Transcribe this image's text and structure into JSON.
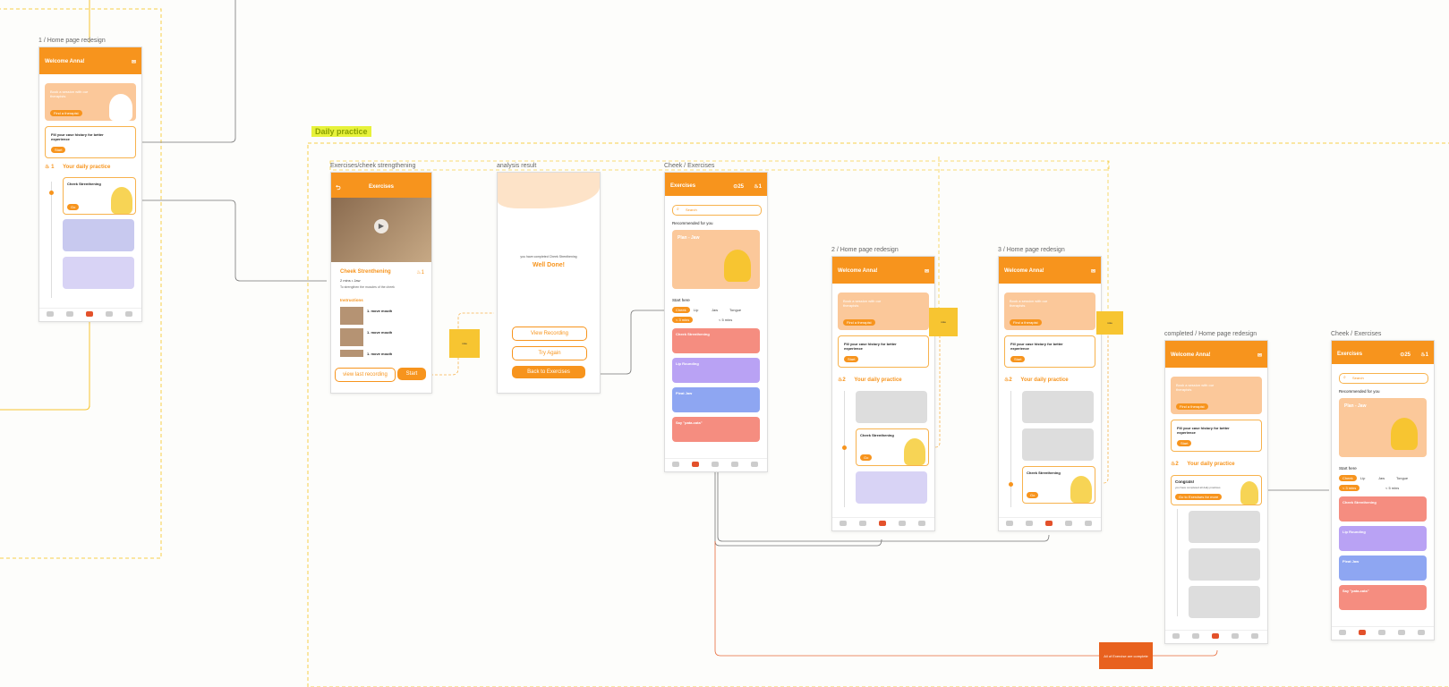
{
  "section_title": "Daily practice",
  "frames": {
    "home1": "1 / Home page redesign",
    "exercise": "Exercises/cheek strengthening",
    "analysis": "analysis result",
    "cheek": "Cheek / Exercises",
    "home2": "2 / Home page redesign",
    "home3": "3 / Home page redesign",
    "completed": "completed / Home page redesign",
    "cheek2": "Cheek / Exercises"
  },
  "home": {
    "welcome": "Welcome Anna!",
    "book_text": "Book a session with our therapists",
    "find_btn": "Find a therapist",
    "fill_text": "Fill your case history for better experience",
    "start_btn": "Start",
    "streak": "1",
    "streak2": "2",
    "daily": "Your daily practice",
    "cheek_title": "Cheek Strenthening",
    "go_btn": "Go"
  },
  "exercise": {
    "header": "Exercises",
    "title": "Cheek Strenthening",
    "meta": "2 mins • Jaw",
    "desc": "To strengthen the muscles of the cheek",
    "instructions": "Instructions",
    "step": "1. move mouth",
    "view_last": "view last recording",
    "start": "Start"
  },
  "analysis": {
    "completed": "you have completed Cheek Strenthening",
    "well_done": "Well Done!",
    "view_recording": "View Recording",
    "try_again": "Try Again",
    "back": "Back to Exercises"
  },
  "cheek": {
    "header": "Exercises",
    "coins": "25",
    "streak": "1",
    "search": "Search",
    "recommended": "Recommended for you",
    "plan_title": "Plan - Jaw",
    "start_here": "Start here",
    "chips": [
      "Cheek",
      "Lip",
      "Jaw",
      "Tongue"
    ],
    "chips2": [
      "< 3 mins",
      "< 5 mins"
    ],
    "cards": [
      "Cheek Strenthening",
      "Lip Rounding",
      "Pleat Jaw",
      "Say \"pata-cata\""
    ]
  },
  "completed": {
    "congrats": "Congrats!",
    "congrats_sub": "you have completed all daily practices",
    "go_btn": "Go to Exercises for more"
  },
  "note_bottom": "All of Exercise are complete",
  "colors": {
    "orange": "#f7941d",
    "peach": "#fbc89a",
    "lavender": "#c8c9ef",
    "red": "#f58d80",
    "purple": "#b9a2f4",
    "blue": "#8ea6f2",
    "yellow": "#f7c531",
    "lime": "#e7f23a"
  }
}
